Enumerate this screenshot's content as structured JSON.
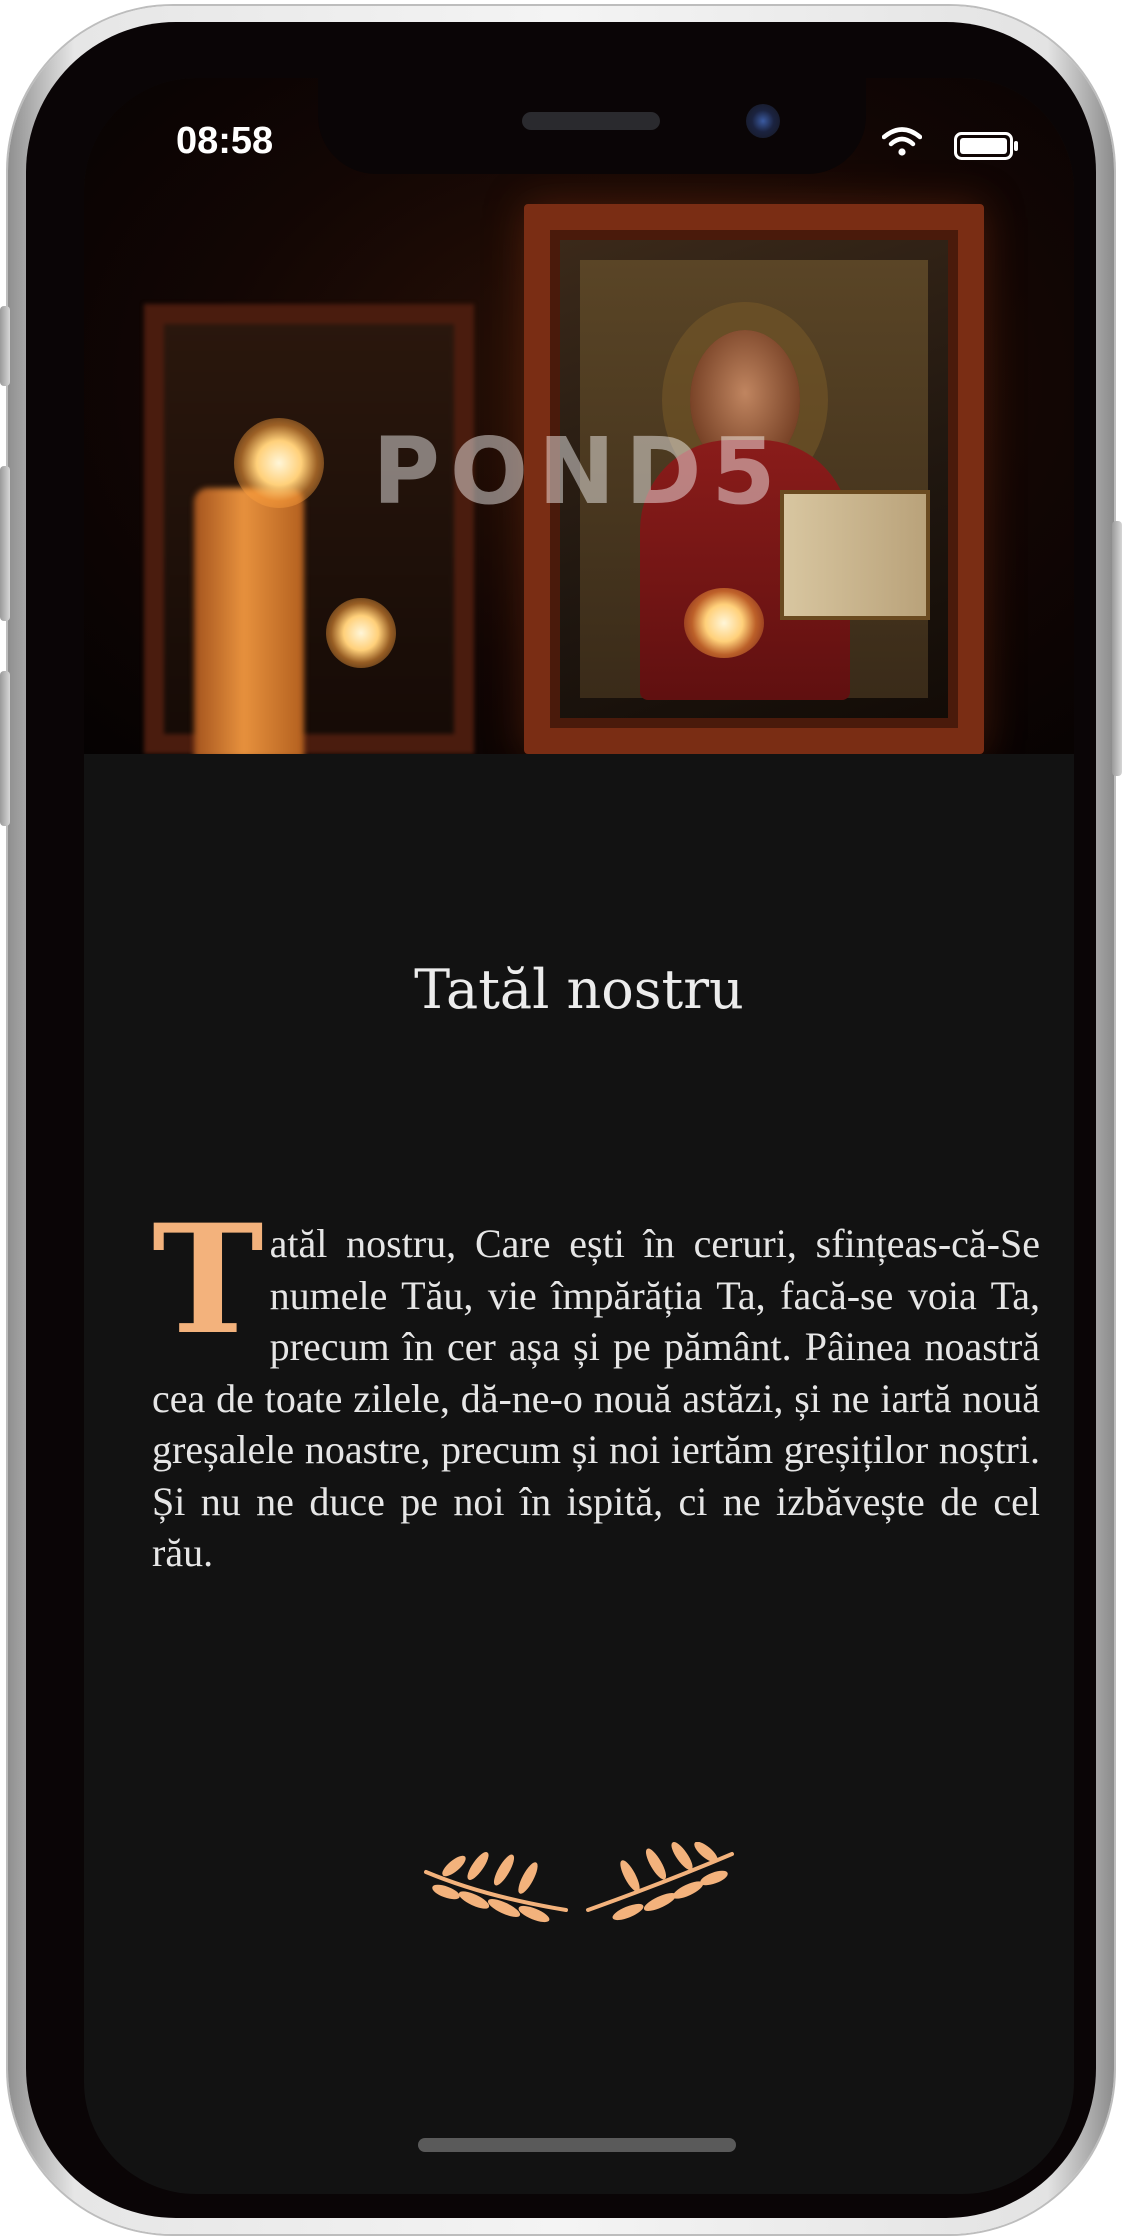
{
  "status_bar": {
    "time": "08:58",
    "icons": [
      "wifi-icon",
      "battery-icon"
    ]
  },
  "hero": {
    "watermark": "POND5"
  },
  "content": {
    "title": "Tatăl nostru",
    "prayer_dropcap": "T",
    "prayer_text": "atăl nostru, Care ești în ceruri, sfințeas-că-Se numele Tău, vie împărăția Ta, facă-se voia Ta, precum în cer așa și pe pământ. Pâinea noastră cea de toate zilele, dă-ne-o nouă astăzi, și ne iartă nouă greșalele noastre, precum și noi iertăm greșiților noștri. Și nu ne duce pe noi în ispită, ci ne izbăvește de cel rău."
  },
  "ornament": {
    "icon": "laurel-branches-icon"
  },
  "colors": {
    "background": "#121212",
    "text": "#e6e6e6",
    "accent": "#f3b27c"
  }
}
